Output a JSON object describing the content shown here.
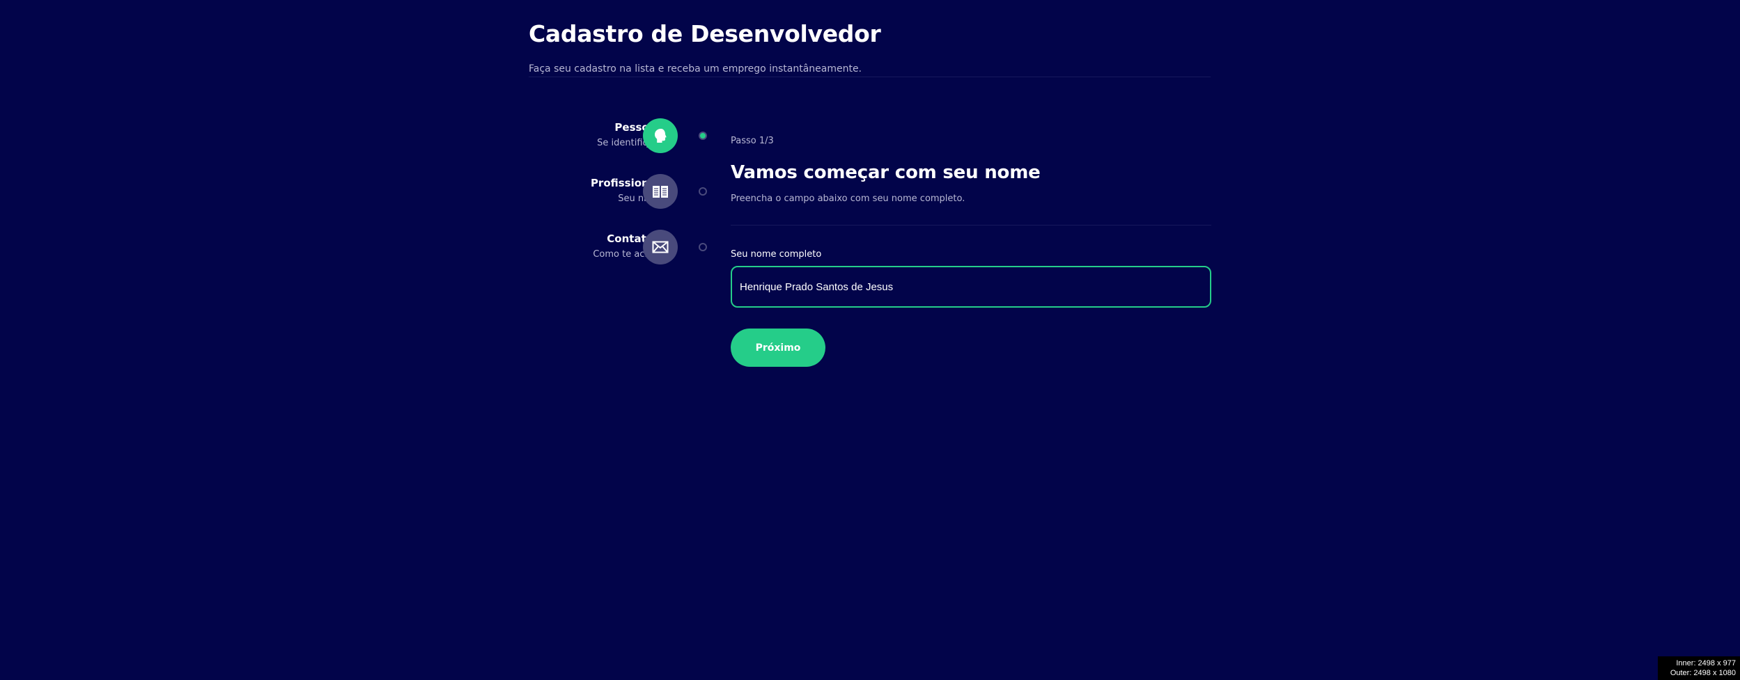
{
  "header": {
    "title": "Cadastro de Desenvolvedor",
    "subtitle": "Faça seu cadastro na lista e receba um emprego instantâneamente."
  },
  "sidebar": {
    "steps": [
      {
        "title": "Pessoal",
        "description": "Se identifique",
        "icon": "profile-icon",
        "active": true
      },
      {
        "title": "Profissional",
        "description": "Seu nível",
        "icon": "book-icon",
        "active": false
      },
      {
        "title": "Contatos",
        "description": "Como te achar",
        "icon": "mail-icon",
        "active": false
      }
    ]
  },
  "form": {
    "step_counter": "Passo 1/3",
    "title": "Vamos começar com seu nome",
    "description": "Preencha o campo abaixo com seu nome completo.",
    "name_label": "Seu nome completo",
    "name_value": "Henrique Prado Santos de Jesus",
    "next_label": "Próximo"
  },
  "viewport_info": {
    "inner": "Inner: 2498 x 977",
    "outer": "Outer: 2498 x 1080"
  },
  "colors": {
    "background": "#02044a",
    "accent": "#25cd89",
    "inactive": "#494a7c",
    "muted_text": "#b8b8d4"
  }
}
